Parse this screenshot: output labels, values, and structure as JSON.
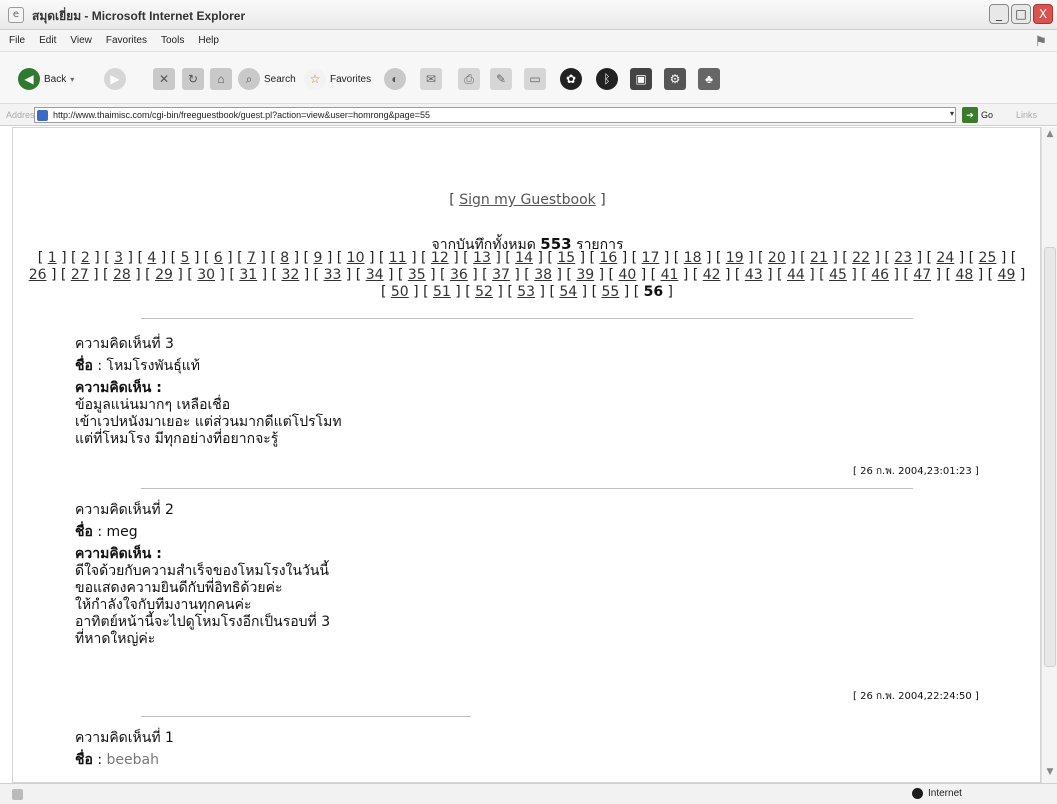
{
  "window": {
    "title": "สมุดเยี่ยม - Microsoft Internet Explorer",
    "controls": [
      "_",
      "□",
      "X"
    ]
  },
  "menu": [
    "File",
    "Edit",
    "View",
    "Favorites",
    "Tools",
    "Help"
  ],
  "toolbar": {
    "back_label": "Back",
    "search_label": "Search",
    "favorites_label": "Favorites"
  },
  "address": {
    "label": "Address",
    "url": "http://www.thaimisc.com/cgi-bin/freeguestbook/guest.pl?action=view&user=homrong&page=55",
    "go_label": "Go",
    "links_label": "Links"
  },
  "status": {
    "zone_label": "Internet"
  },
  "page": {
    "sign_open": "[ ",
    "sign_link": "Sign my Guestbook",
    "sign_close": " ]",
    "total_prefix": "จากบันทึกทั้งหมด",
    "total_count": "553",
    "total_suffix": "รายการ",
    "pages": [
      "1",
      "2",
      "3",
      "4",
      "5",
      "6",
      "7",
      "8",
      "9",
      "10",
      "11",
      "12",
      "13",
      "14",
      "15",
      "16",
      "17",
      "18",
      "19",
      "20",
      "21",
      "22",
      "23",
      "24",
      "25",
      "26",
      "27",
      "28",
      "29",
      "30",
      "31",
      "32",
      "33",
      "34",
      "35",
      "36",
      "37",
      "38",
      "39",
      "40",
      "41",
      "42",
      "43",
      "44",
      "45",
      "46",
      "47",
      "48",
      "49",
      "50",
      "51",
      "52",
      "53",
      "54",
      "55",
      "56"
    ],
    "current_page": "56"
  },
  "entries": [
    {
      "title": "ความคิดเห็นที่ 3",
      "name_label": "ชื่อ",
      "name_value": "โหมโรงพันธุ์แท้",
      "comment_label": "ความคิดเห็น :",
      "lines": [
        "ข้อมูลแน่นมากๆ เหลือเชื่อ",
        "เข้าเวปหนังมาเยอะ แต่ส่วนมากดีแต่โปรโมท",
        "แต่ที่โหมโรง มีทุกอย่างที่อยากจะรู้"
      ],
      "date": "[ 26 ก.พ. 2004,23:01:23 ]"
    },
    {
      "title": "ความคิดเห็นที่ 2",
      "name_label": "ชื่อ",
      "name_value": "meg",
      "comment_label": "ความคิดเห็น :",
      "lines": [
        "ดีใจด้วยกับความสำเร็จของโหมโรงในวันนี้",
        "ขอแสดงความยินดีกับพี่อิทธิด้วยค่ะ",
        "ให้กำลังใจกับทีมงานทุกคนค่ะ",
        "อาทิตย์หน้านี้จะไปดูโหมโรงอีกเป็นรอบที่ 3",
        "ที่หาดใหญ่ค่ะ"
      ],
      "date": "[ 26 ก.พ. 2004,22:24:50 ]"
    },
    {
      "title": "ความคิดเห็นที่ 1",
      "name_label": "ชื่อ",
      "name_value": "beebah"
    }
  ]
}
